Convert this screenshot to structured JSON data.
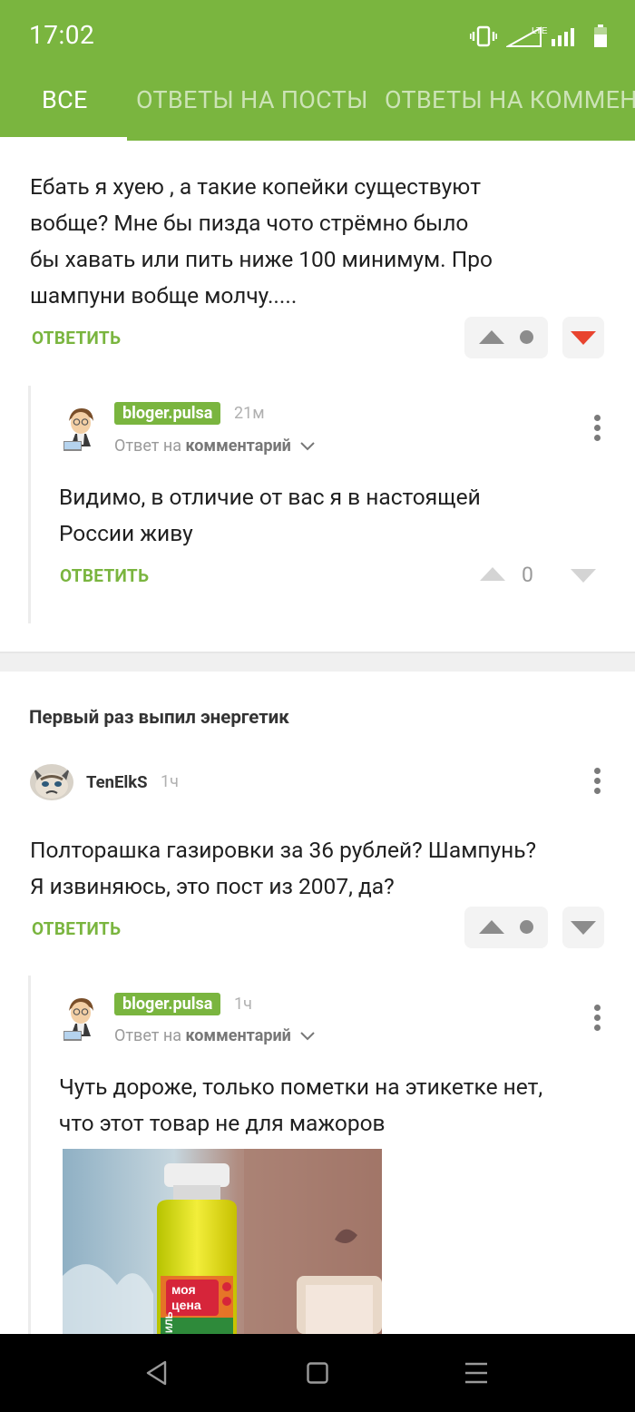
{
  "status": {
    "time": "17:02",
    "network": "LTE"
  },
  "tabs": [
    {
      "label": "ВСЕ",
      "active": true
    },
    {
      "label": "ОТВЕТЫ НА ПОСТЫ",
      "active": false
    },
    {
      "label": "ОТВЕТЫ НА КОММЕНТАРИИ",
      "active": false
    }
  ],
  "comment1": {
    "text_lines": [
      "Ебать я хуею , а такие копейки существуют",
      "вобще? Мне бы пизда чото стрёмно было",
      "бы хавать или пить ниже 100 минимум. Про",
      "шампуни вобще молчу....."
    ],
    "reply_label": "ОТВЕТИТЬ",
    "downvoted": true
  },
  "reply1": {
    "username": "bloger.pulsa",
    "time": "21м",
    "reply_to_prefix": "Ответ на",
    "reply_to_target": "комментарий",
    "text_lines": [
      "Видимо, в отличие от вас я в настоящей",
      "России живу"
    ],
    "reply_label": "ОТВЕТИТЬ",
    "rating": "0"
  },
  "post2": {
    "title": "Первый раз выпил энергетик"
  },
  "comment2": {
    "username": "TenElkS",
    "time": "1ч",
    "text_lines": [
      "Полторашка газировки за 36 рублей? Шампунь?",
      "Я извиняюсь, это пост из 2007, да?"
    ],
    "reply_label": "ОТВЕТИТЬ"
  },
  "reply2": {
    "username": "bloger.pulsa",
    "time": "1ч",
    "reply_to_prefix": "Ответ на",
    "reply_to_target": "комментарий",
    "text_lines": [
      "Чуть дороже, только пометки на этикетке нет,",
      "что этот товар не для мажоров"
    ],
    "image_label_lines": [
      "моя",
      "цена"
    ],
    "image_side_label": "ИЛЬ"
  },
  "colors": {
    "brand_green": "#7ab53f",
    "downvote_red": "#e8442f",
    "icon_grey": "#8c8c8c"
  },
  "icons": {
    "vibrate": "vibrate-icon",
    "signal": "signal-icon",
    "battery": "battery-icon",
    "up": "arrow-up-icon",
    "down": "arrow-down-icon",
    "menu": "more-vertical-icon",
    "chevron": "chevron-down-icon",
    "nav_back": "back-icon",
    "nav_home": "home-icon",
    "nav_recent": "recent-apps-icon"
  }
}
